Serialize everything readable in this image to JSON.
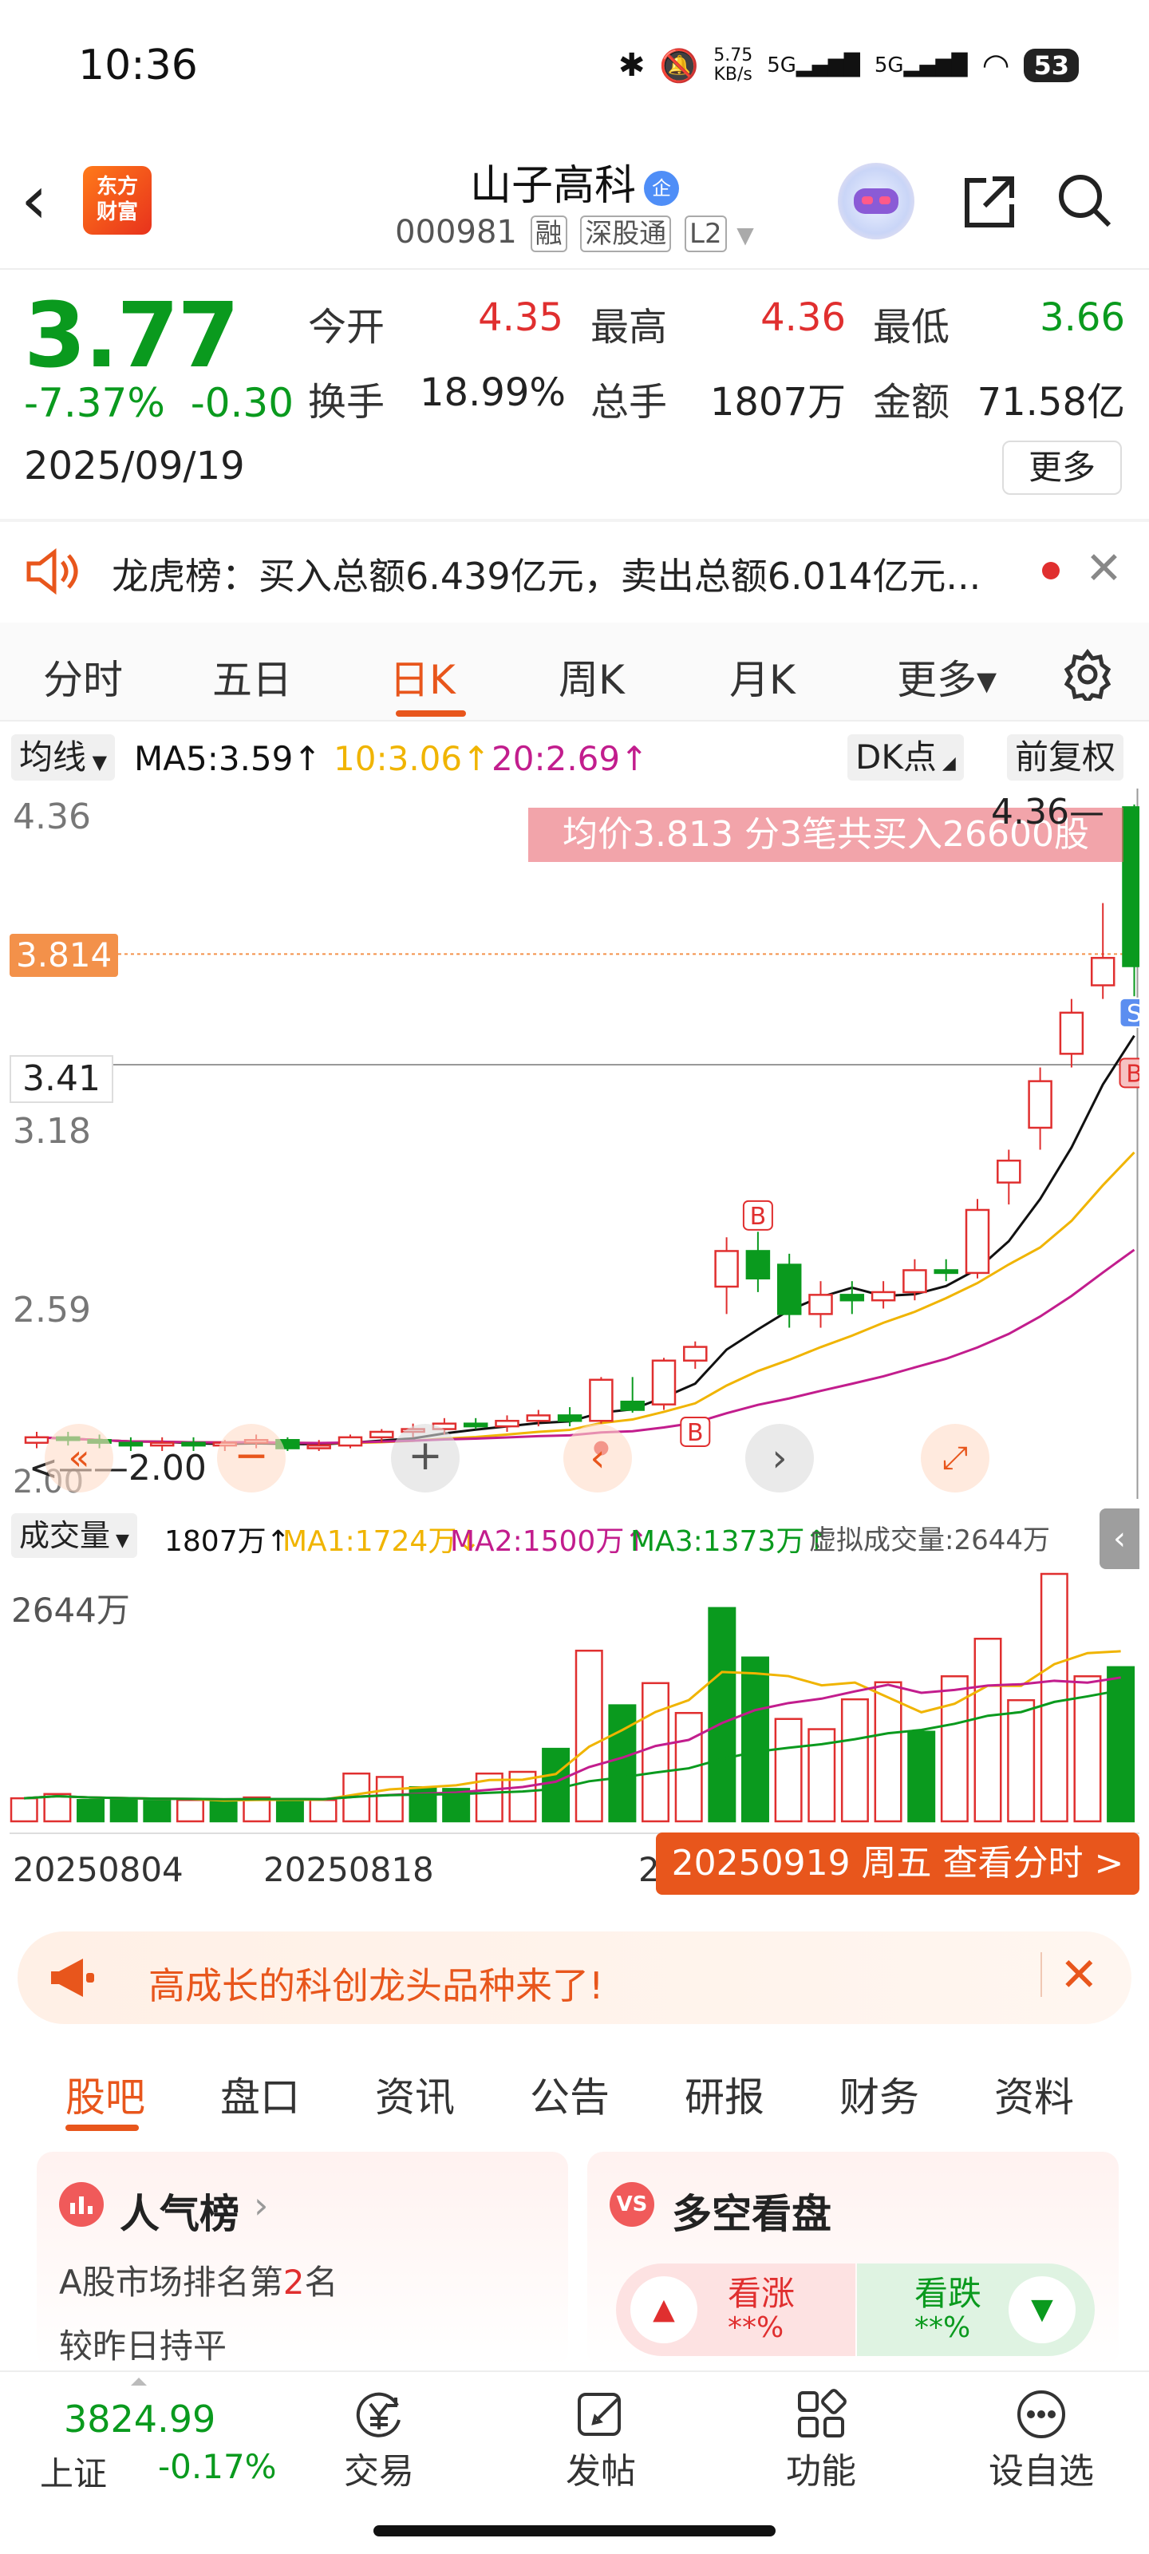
{
  "status_bar": {
    "time": "10:36",
    "net_speed_top": "5.75",
    "net_speed_unit": "KB/s",
    "signal1": "5G",
    "signal2": "5G",
    "battery": "53"
  },
  "header": {
    "logo_line1": "东方",
    "logo_line2": "财富",
    "stock_name": "山子高科",
    "qy_badge": "企",
    "code": "000981",
    "tags": [
      "融",
      "深股通",
      "L2"
    ]
  },
  "quote": {
    "price": "3.77",
    "change_pct": "-7.37%",
    "change": "-0.30",
    "date": "2025/09/19",
    "open_label": "今开",
    "open": "4.35",
    "high_label": "最高",
    "high": "4.36",
    "low_label": "最低",
    "low": "3.66",
    "turnover_label": "换手",
    "turnover": "18.99%",
    "volume_label": "总手",
    "volume": "1807万",
    "amount_label": "金额",
    "amount": "71.58亿",
    "more": "更多"
  },
  "lhb": {
    "text": "龙虎榜：买入总额6.439亿元，卖出总额6.014亿元..."
  },
  "period_tabs": [
    "分时",
    "五日",
    "日K",
    "周K",
    "月K",
    "更多▾"
  ],
  "ma": {
    "selector": "均线",
    "ma5": "MA5:3.59↑",
    "ma10": "10:3.06↑",
    "ma20": "20:2.69↑",
    "dk": "DK点",
    "adjust": "前复权"
  },
  "chart_labels": {
    "top_price": "4.36",
    "cursor_price": "3.814",
    "level_341": "3.41",
    "level_318": "3.18",
    "level_259": "2.59",
    "low_price": "2.00",
    "low_marker": "<——2.00",
    "peak_marker": "4.36—",
    "tooltip": "均价3.813  分3笔共买入26600股"
  },
  "volume": {
    "selector": "成交量",
    "total": "1807万↑",
    "ma1": "MA1:1724万↓",
    "ma2": "MA2:1500万↑",
    "ma3": "MA3:1373万↑",
    "virtual": "虚拟成交量:2644万",
    "top": "2644万"
  },
  "x_axis": {
    "d1": "20250804",
    "d2": "20250818",
    "d3": "2",
    "tip": "20250919 周五 查看分时 >"
  },
  "banner": {
    "text": "高成长的科创龙头品种来了!"
  },
  "bottom_tabs": [
    "股吧",
    "盘口",
    "资讯",
    "公告",
    "研报",
    "财务",
    "资料"
  ],
  "cards": {
    "left_title": "人气榜",
    "left_line1_pre": "A股市场排名第",
    "left_rank": "2",
    "left_line1_post": "名",
    "left_line2": "较昨日持平",
    "right_title": "多空看盘",
    "bull": "看涨",
    "bull_val": "**%",
    "bear": "看跌",
    "bear_val": "**%"
  },
  "index": {
    "value": "3824.99",
    "name": "上证",
    "change": "-0.17%"
  },
  "nav": [
    "交易",
    "发帖",
    "功能",
    "设自选"
  ],
  "chart_data": {
    "type": "candlestick",
    "candles": [
      {
        "o": 2.03,
        "c": 2.05,
        "h": 2.07,
        "l": 2.01
      },
      {
        "o": 2.05,
        "c": 2.04,
        "h": 2.07,
        "l": 2.02
      },
      {
        "o": 2.04,
        "c": 2.03,
        "h": 2.06,
        "l": 2.01
      },
      {
        "o": 2.03,
        "c": 2.02,
        "h": 2.05,
        "l": 2.0
      },
      {
        "o": 2.02,
        "c": 2.03,
        "h": 2.05,
        "l": 2.0
      },
      {
        "o": 2.03,
        "c": 2.02,
        "h": 2.05,
        "l": 2.0
      },
      {
        "o": 2.02,
        "c": 2.03,
        "h": 2.04,
        "l": 2.0
      },
      {
        "o": 2.03,
        "c": 2.04,
        "h": 2.06,
        "l": 2.01
      },
      {
        "o": 2.04,
        "c": 2.01,
        "h": 2.05,
        "l": 2.0
      },
      {
        "o": 2.01,
        "c": 2.02,
        "h": 2.04,
        "l": 2.0
      },
      {
        "o": 2.02,
        "c": 2.05,
        "h": 2.06,
        "l": 2.01
      },
      {
        "o": 2.05,
        "c": 2.07,
        "h": 2.08,
        "l": 2.03
      },
      {
        "o": 2.07,
        "c": 2.08,
        "h": 2.1,
        "l": 2.05
      },
      {
        "o": 2.08,
        "c": 2.1,
        "h": 2.12,
        "l": 2.06
      },
      {
        "o": 2.1,
        "c": 2.09,
        "h": 2.12,
        "l": 2.08
      },
      {
        "o": 2.09,
        "c": 2.11,
        "h": 2.13,
        "l": 2.07
      },
      {
        "o": 2.11,
        "c": 2.13,
        "h": 2.15,
        "l": 2.09
      },
      {
        "o": 2.13,
        "c": 2.11,
        "h": 2.16,
        "l": 2.09
      },
      {
        "o": 2.11,
        "c": 2.26,
        "h": 2.27,
        "l": 2.1
      },
      {
        "o": 2.18,
        "c": 2.15,
        "h": 2.27,
        "l": 2.14
      },
      {
        "o": 2.17,
        "c": 2.33,
        "h": 2.34,
        "l": 2.15
      },
      {
        "o": 2.33,
        "c": 2.38,
        "h": 2.4,
        "l": 2.3
      },
      {
        "o": 2.6,
        "c": 2.73,
        "h": 2.78,
        "l": 2.5
      },
      {
        "o": 2.73,
        "c": 2.63,
        "h": 2.8,
        "l": 2.58
      },
      {
        "o": 2.68,
        "c": 2.5,
        "h": 2.72,
        "l": 2.45
      },
      {
        "o": 2.5,
        "c": 2.57,
        "h": 2.62,
        "l": 2.45
      },
      {
        "o": 2.57,
        "c": 2.55,
        "h": 2.62,
        "l": 2.5
      },
      {
        "o": 2.55,
        "c": 2.58,
        "h": 2.62,
        "l": 2.52
      },
      {
        "o": 2.58,
        "c": 2.66,
        "h": 2.7,
        "l": 2.55
      },
      {
        "o": 2.66,
        "c": 2.65,
        "h": 2.7,
        "l": 2.62
      },
      {
        "o": 2.65,
        "c": 2.88,
        "h": 2.92,
        "l": 2.63
      },
      {
        "o": 2.98,
        "c": 3.06,
        "h": 3.1,
        "l": 2.9
      },
      {
        "o": 3.18,
        "c": 3.35,
        "h": 3.4,
        "l": 3.1
      },
      {
        "o": 3.45,
        "c": 3.6,
        "h": 3.65,
        "l": 3.4
      },
      {
        "o": 3.7,
        "c": 3.8,
        "h": 4.0,
        "l": 3.65
      },
      {
        "o": 4.35,
        "c": 3.77,
        "h": 4.36,
        "l": 3.66
      }
    ],
    "volumes": [
      {
        "v": 270,
        "up": true
      },
      {
        "v": 320,
        "up": true
      },
      {
        "v": 250,
        "up": false
      },
      {
        "v": 250,
        "up": false
      },
      {
        "v": 240,
        "up": false
      },
      {
        "v": 250,
        "up": true
      },
      {
        "v": 230,
        "up": false
      },
      {
        "v": 280,
        "up": true
      },
      {
        "v": 260,
        "up": false
      },
      {
        "v": 250,
        "up": true
      },
      {
        "v": 560,
        "up": true
      },
      {
        "v": 520,
        "up": true
      },
      {
        "v": 400,
        "up": false
      },
      {
        "v": 380,
        "up": false
      },
      {
        "v": 560,
        "up": true
      },
      {
        "v": 580,
        "up": true
      },
      {
        "v": 850,
        "up": false
      },
      {
        "v": 2000,
        "up": true
      },
      {
        "v": 1360,
        "up": false
      },
      {
        "v": 1620,
        "up": true
      },
      {
        "v": 1270,
        "up": true
      },
      {
        "v": 2500,
        "up": false
      },
      {
        "v": 1920,
        "up": false
      },
      {
        "v": 1200,
        "up": true
      },
      {
        "v": 1080,
        "up": true
      },
      {
        "v": 1430,
        "up": true
      },
      {
        "v": 1630,
        "up": true
      },
      {
        "v": 1050,
        "up": false
      },
      {
        "v": 1700,
        "up": true
      },
      {
        "v": 2140,
        "up": true
      },
      {
        "v": 1420,
        "up": true
      },
      {
        "v": 2900,
        "up": true
      },
      {
        "v": 1700,
        "up": true
      },
      {
        "v": 1807,
        "up": false
      }
    ],
    "ma_colors": {
      "ma5": "#111111",
      "ma10": "#f0b400",
      "ma20": "#c21d8d"
    },
    "ylim": [
      2.0,
      4.36
    ],
    "vol_max": 2900
  },
  "colors": {
    "up": "#e02f2f",
    "down": "#0a9a1e",
    "accent": "#e8561c"
  }
}
